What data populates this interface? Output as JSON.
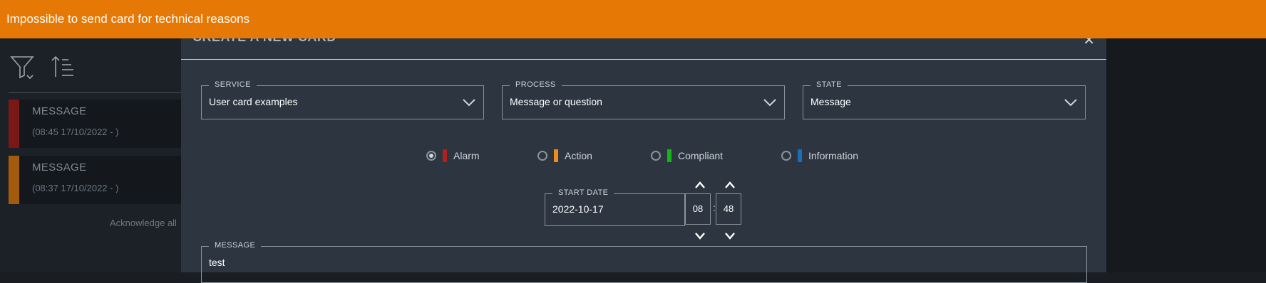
{
  "toast": {
    "message": "Impossible to send card for technical reasons",
    "color": "#e67805"
  },
  "feed": {
    "icons": [
      "filter-icon",
      "sort-icon"
    ],
    "cards": [
      {
        "title": "MESSAGE",
        "time": "(08:45 17/10/2022 - )",
        "severity_color": "#7a1717"
      },
      {
        "title": "MESSAGE",
        "time": "(08:37 17/10/2022 - )",
        "severity_color": "#a35c0b"
      }
    ],
    "acknowledge_all": "Acknowledge all"
  },
  "modal": {
    "title": "CREATE A NEW CARD",
    "close_icon": "close-icon",
    "service": {
      "label": "SERVICE",
      "value": "User card examples"
    },
    "process": {
      "label": "PROCESS",
      "value": "Message or question"
    },
    "state": {
      "label": "STATE",
      "value": "Message"
    },
    "severities": [
      {
        "label": "Alarm",
        "color": "#b41e1e",
        "selected": true
      },
      {
        "label": "Action",
        "color": "#f08c19",
        "selected": false
      },
      {
        "label": "Compliant",
        "color": "#13b713",
        "selected": false
      },
      {
        "label": "Information",
        "color": "#1a6fb4",
        "selected": false
      }
    ],
    "start_date": {
      "label": "START DATE",
      "value": "2022-10-17",
      "hour": "08",
      "minute": "48",
      "separator": ":"
    },
    "message": {
      "label": "MESSAGE",
      "value": "test"
    }
  }
}
